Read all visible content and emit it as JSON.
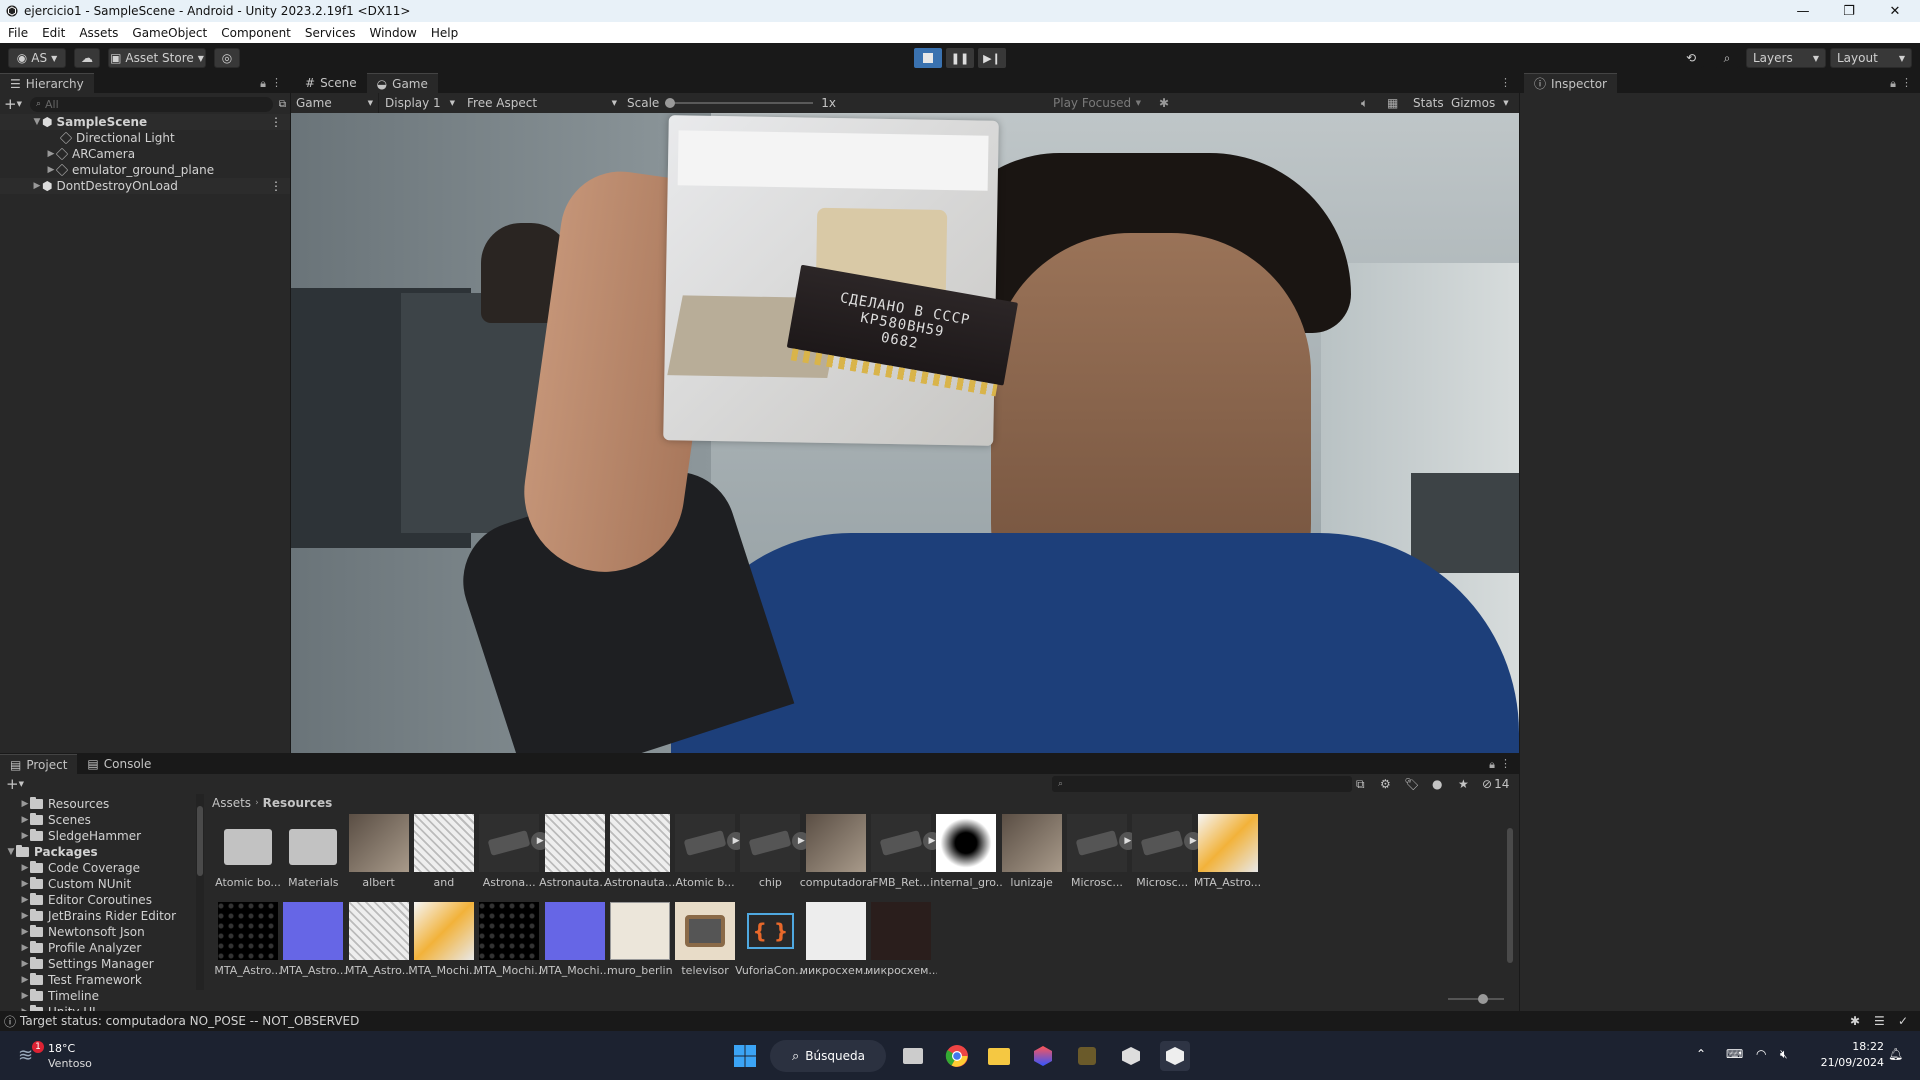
{
  "window": {
    "title": "ejercicio1 - SampleScene - Android - Unity 2023.2.19f1 <DX11>",
    "minimize": "—",
    "maximize": "❐",
    "close": "✕"
  },
  "menu": [
    "File",
    "Edit",
    "Assets",
    "GameObject",
    "Component",
    "Services",
    "Window",
    "Help"
  ],
  "toolbar": {
    "account": "AS",
    "asset_store": "Asset Store",
    "layers": "Layers",
    "layout": "Layout"
  },
  "hierarchy": {
    "tab": "Hierarchy",
    "search_placeholder": "All",
    "scene": "SampleScene",
    "items": [
      "Directional Light",
      "ARCamera",
      "emulator_ground_plane"
    ],
    "ddol": "DontDestroyOnLoad"
  },
  "center_tabs": {
    "scene": "Scene",
    "game": "Game"
  },
  "game_toolbar": {
    "mode": "Game",
    "display": "Display 1",
    "aspect": "Free Aspect",
    "scale_label": "Scale",
    "scale_value": "1x",
    "play_focused": "Play Focused",
    "stats": "Stats",
    "gizmos": "Gizmos"
  },
  "chip_text": [
    "СДЕЛАНО В СССР",
    "КР580ВН59",
    "0682"
  ],
  "inspector": {
    "tab": "Inspector"
  },
  "project": {
    "tab_project": "Project",
    "tab_console": "Console",
    "hidden_count": "14",
    "breadcrumb_root": "Assets",
    "breadcrumb_current": "Resources",
    "tree": [
      {
        "label": "Resources",
        "indent": 1
      },
      {
        "label": "Scenes",
        "indent": 1
      },
      {
        "label": "SledgeHammer",
        "indent": 1
      },
      {
        "label": "Packages",
        "indent": 0
      },
      {
        "label": "Code Coverage",
        "indent": 1
      },
      {
        "label": "Custom NUnit",
        "indent": 1
      },
      {
        "label": "Editor Coroutines",
        "indent": 1
      },
      {
        "label": "JetBrains Rider Editor",
        "indent": 1
      },
      {
        "label": "Newtonsoft Json",
        "indent": 1
      },
      {
        "label": "Profile Analyzer",
        "indent": 1
      },
      {
        "label": "Settings Manager",
        "indent": 1
      },
      {
        "label": "Test Framework",
        "indent": 1
      },
      {
        "label": "Timeline",
        "indent": 1
      },
      {
        "label": "Unity UI",
        "indent": 1
      }
    ],
    "assets_row1": [
      "Atomic bo...",
      "Materials",
      "albert",
      "and",
      "Astrona...",
      "Astronauta...",
      "Astronauta...",
      "Atomic b...",
      "chip",
      "computadora",
      "FMB_Ret...",
      "internal_gro...",
      "lunizaje",
      "Microsc...",
      "Microsc...",
      "MTA_Astro..."
    ],
    "assets_row2": [
      "MTA_Astro...",
      "MTA_Astro...",
      "MTA_Astro...",
      "MTA_Mochi...",
      "MTA_Mochi...",
      "MTA_Mochi...",
      "muro_berlin",
      "televisor",
      "VuforiaCon...",
      "микросхем...",
      "микросхем..."
    ]
  },
  "status": {
    "message": "Target status: computadora NO_POSE -- NOT_OBSERVED"
  },
  "taskbar": {
    "weather_temp": "18°C",
    "weather_desc": "Ventoso",
    "notification_count": "1",
    "search_label": "Búsqueda",
    "time": "18:22",
    "date": "21/09/2024"
  }
}
